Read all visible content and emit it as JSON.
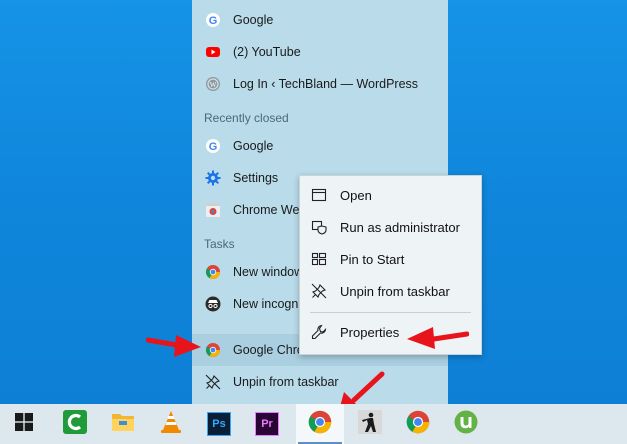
{
  "jumplist": {
    "pinned": [
      {
        "label": "Google",
        "icon": "google-g-icon"
      },
      {
        "label": "(2) YouTube",
        "icon": "youtube-icon"
      },
      {
        "label": "Log In ‹ TechBland — WordPress",
        "icon": "wordpress-icon"
      }
    ],
    "recently_closed_header": "Recently closed",
    "recently_closed": [
      {
        "label": "Google",
        "icon": "google-g-icon"
      },
      {
        "label": "Settings",
        "icon": "settings-gear-icon"
      },
      {
        "label": "Chrome Web",
        "icon": "chrome-web-store-icon"
      }
    ],
    "tasks_header": "Tasks",
    "tasks": [
      {
        "label": "New window",
        "icon": "chrome-icon"
      },
      {
        "label": "New incognito",
        "icon": "incognito-icon"
      }
    ],
    "app_label": "Google Chrome Beta",
    "unpin_label": "Unpin from taskbar"
  },
  "context_menu": {
    "items": [
      {
        "label": "Open",
        "icon": "window-icon"
      },
      {
        "label": "Run as administrator",
        "icon": "shield-icon"
      },
      {
        "label": "Pin to Start",
        "icon": "pin-to-start-icon"
      },
      {
        "label": "Unpin from taskbar",
        "icon": "unpin-icon"
      },
      {
        "label": "Properties",
        "icon": "wrench-icon"
      }
    ]
  },
  "taskbar": {
    "icons": [
      "windows-start-icon",
      "camtasia-icon",
      "file-explorer-icon",
      "vlc-icon",
      "photoshop-icon",
      "premiere-icon",
      "chrome-beta-icon",
      "counter-strike-icon",
      "chrome-icon",
      "utorrent-icon"
    ],
    "photoshop_text": "Ps",
    "premiere_text": "Pr",
    "active": "chrome-beta-icon"
  },
  "colors": {
    "arrow": "#e8141b",
    "desktop": "#0f86db",
    "jumplist_bg": "#b9dbea"
  }
}
